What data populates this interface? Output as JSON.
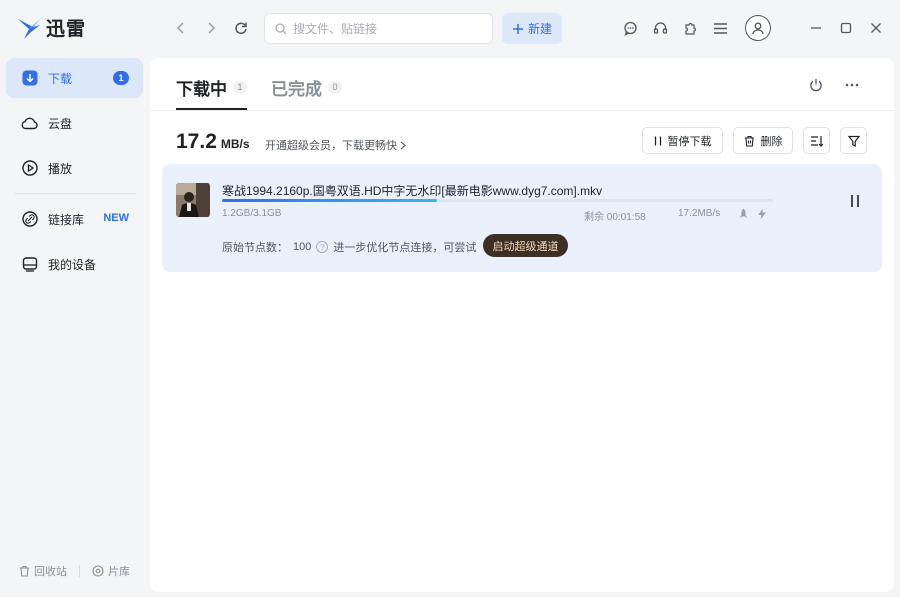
{
  "app": {
    "brand": "迅雷"
  },
  "search": {
    "placeholder": "搜文件、贴链接"
  },
  "toolbar": {
    "new_label": "新建"
  },
  "sidebar": {
    "items": [
      {
        "label": "下载",
        "badge": "1"
      },
      {
        "label": "云盘"
      },
      {
        "label": "播放"
      },
      {
        "label": "链接库",
        "tag": "NEW"
      },
      {
        "label": "我的设备"
      }
    ],
    "footer": {
      "recycle": "回收站",
      "library": "片库"
    }
  },
  "tabs": [
    {
      "label": "下载中",
      "count": "1"
    },
    {
      "label": "已完成",
      "count": "0"
    }
  ],
  "speed": {
    "value": "17.2",
    "unit": "MB/s",
    "vip_text": "开通超级会员，下载更畅快"
  },
  "actions": {
    "pause_all": "暂停下载",
    "delete": "删除"
  },
  "task": {
    "filename": "寒战1994.2160p.国粤双语.HD中字无水印[最新电影www.dyg7.com].mkv",
    "progress": 0.39,
    "size": "1.2GB/3.1GB",
    "remaining": "剩余 00:01:58",
    "rate": "17.2MB/s",
    "nodes_label": "原始节点数：",
    "nodes_count": "100",
    "optimize_text": "进一步优化节点连接，可尝试",
    "super_channel": "启动超级通道"
  },
  "colors": {
    "accent": "#2f6fec",
    "active_bg": "#dde7fa",
    "task_bg": "#eaf1fd",
    "super_btn": "#3d2e26"
  }
}
